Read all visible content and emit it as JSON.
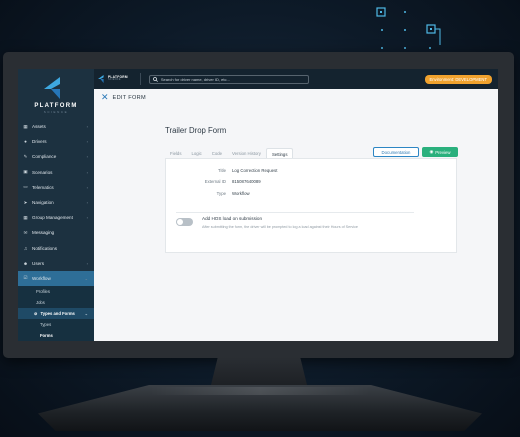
{
  "topbar": {
    "logo_text": "PLATFORM",
    "logo_sub": "SCIENCE",
    "search_placeholder": "Search for driver name, driver ID, etc...",
    "env_badge": "Environment: DEVELOPMENT",
    "env_color": "#f0a22e"
  },
  "sidebar": {
    "brand_title": "PLATFORM",
    "brand_sub": "SCIENCE",
    "items": [
      {
        "icon": "assets-icon",
        "label": "Assets",
        "glyph": "▦"
      },
      {
        "icon": "drivers-icon",
        "label": "Drivers",
        "glyph": "●"
      },
      {
        "icon": "compliance-icon",
        "label": "Compliance",
        "glyph": "✎"
      },
      {
        "icon": "scenarios-icon",
        "label": "Scenarios",
        "glyph": "▣"
      },
      {
        "icon": "telematics-icon",
        "label": "Telematics",
        "glyph": "▭"
      },
      {
        "icon": "navigation-icon",
        "label": "Navigation",
        "glyph": "➤"
      },
      {
        "icon": "group-management-icon",
        "label": "Group Management",
        "glyph": "▦"
      },
      {
        "icon": "messaging-icon",
        "label": "Messaging",
        "glyph": "✉"
      },
      {
        "icon": "notifications-icon",
        "label": "Notifications",
        "glyph": "♫"
      },
      {
        "icon": "users-icon",
        "label": "Users",
        "glyph": "☻"
      },
      {
        "icon": "workflow-icon",
        "label": "Workflow",
        "glyph": "☑"
      }
    ],
    "sub_items": {
      "profiles": "Profiles",
      "jobs": "Jobs",
      "types_and_forms": "Types and Forms",
      "types": "Types",
      "forms": "Forms"
    }
  },
  "page": {
    "title": "EDIT FORM",
    "form_title": "Trailer Drop Form",
    "tabs": [
      "Fields",
      "Logic",
      "Code",
      "Version History",
      "Settings"
    ],
    "active_tab": "Settings",
    "documentation_label": "Documentation",
    "preview_label": "Preview",
    "preview_color": "#2ab07d",
    "fields": [
      {
        "key": "Title",
        "value": "Log Correction Request"
      },
      {
        "key": "External ID",
        "value": "815087640089"
      },
      {
        "key": "Type",
        "value": "Workflow"
      }
    ],
    "hos_toggle": {
      "label": "Add HOS load on submission",
      "description": "After submitting the form, the driver will be prompted to log a load against their Hours of Service",
      "enabled": false
    }
  }
}
